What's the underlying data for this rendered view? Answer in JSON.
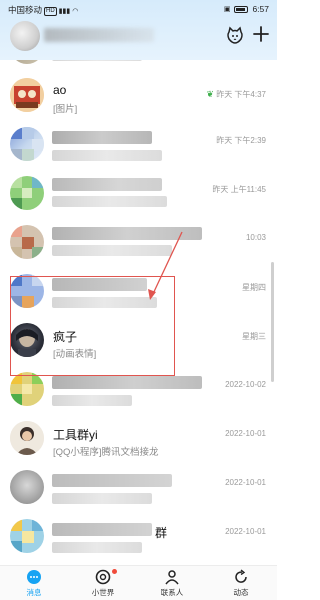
{
  "status_bar": {
    "carrier": "中国移动",
    "carrier_badge": "HD",
    "time": "6:57"
  },
  "conversations": [
    {
      "name": "",
      "subtitle": "",
      "time": "",
      "blurred": true
    },
    {
      "name": "ao",
      "subtitle": "[图片]",
      "time": "昨天 下午4:37",
      "blurred": false,
      "icon": "sprout-icon"
    },
    {
      "name": "",
      "subtitle": "",
      "time": "昨天 下午2:39",
      "blurred": true
    },
    {
      "name": "",
      "subtitle": "",
      "time": "昨天 上午11:45",
      "blurred": true
    },
    {
      "name": "",
      "subtitle": "",
      "time": "10:03",
      "blurred": true
    },
    {
      "name": "",
      "subtitle": "",
      "time": "星期四",
      "blurred": true
    },
    {
      "name": "疯子",
      "subtitle": "[动画表情]",
      "time": "星期三",
      "blurred": false
    },
    {
      "name": "",
      "subtitle": "",
      "time": "2022-10-02",
      "blurred": true
    },
    {
      "name": "工具群yi",
      "subtitle": "[QQ小程序]腾讯文档接龙",
      "time": "2022-10-01",
      "blurred": false
    },
    {
      "name": "",
      "subtitle": "",
      "time": "2022-10-01",
      "blurred": true
    },
    {
      "name": "群",
      "subtitle": "",
      "time": "2022-10-01",
      "blurred": true
    }
  ],
  "tabs": [
    {
      "label": "消息",
      "icon": "message-icon",
      "active": true
    },
    {
      "label": "小世界",
      "icon": "world-icon",
      "active": false
    },
    {
      "label": "联系人",
      "icon": "contacts-icon",
      "active": false
    },
    {
      "label": "动态",
      "icon": "refresh-icon",
      "active": false
    }
  ],
  "colors": {
    "accent": "#16a3f3",
    "highlight": "#e0554f",
    "badge": "#f04a3a"
  }
}
